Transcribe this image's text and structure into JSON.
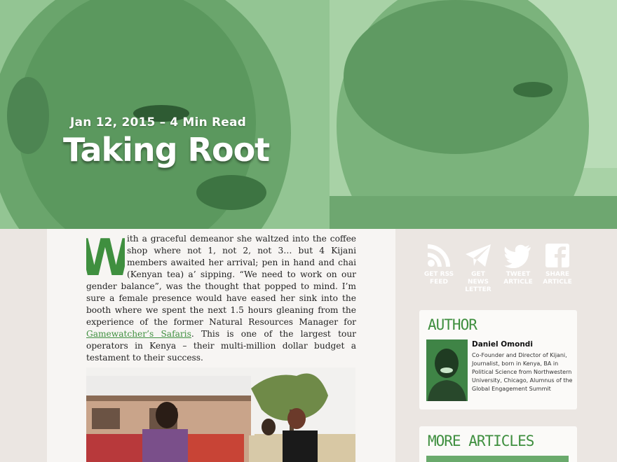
{
  "hero": {
    "date": "Jan 12, 2015",
    "separator": "–",
    "read_time": "4 Min Read",
    "title": "Taking Root"
  },
  "article": {
    "dropcap": "W",
    "text_before_link": "ith a graceful demeanor she waltzed into the coffee shop where not 1, not 2, not 3… but 4 Kijani members awaited her arrival; pen in hand and chai (Kenyan tea) a’ sipping. “We need to work on our gender balance”, was the thought that popped to mind. I’m sure a female presence would have eased her sink into the booth where we spent the next 1.5 hours gleaning from the experience of the former Natural Resources Manager for ",
    "link_text": "Gamewatcher’s Safaris",
    "text_after_link": ". This is one of the largest tour operators in Kenya – their multi-million dollar budget a testament to their success."
  },
  "share": {
    "rss_line1": "GET RSS",
    "rss_line2": "FEED",
    "news_line1": "GET NEWS",
    "news_line2": "LETTER",
    "tweet_line1": "TWEET",
    "tweet_line2": "ARTICLE",
    "share_line1": "SHARE",
    "share_line2": "ARTICLE"
  },
  "author_card": {
    "title": "AUTHOR",
    "name": "Daniel Omondi",
    "bio": "Co-Founder and Director of Kijani, Journalist, born in Kenya, BA in Political Science from Northwestern University, Chicago, Alumnus of the Global Engagement Summit"
  },
  "more_card": {
    "title": "MORE ARTICLES"
  },
  "colors": {
    "accent": "#3f8f3f",
    "hero_tint": "#8fc28f",
    "page_bg": "#ebe6e2"
  }
}
